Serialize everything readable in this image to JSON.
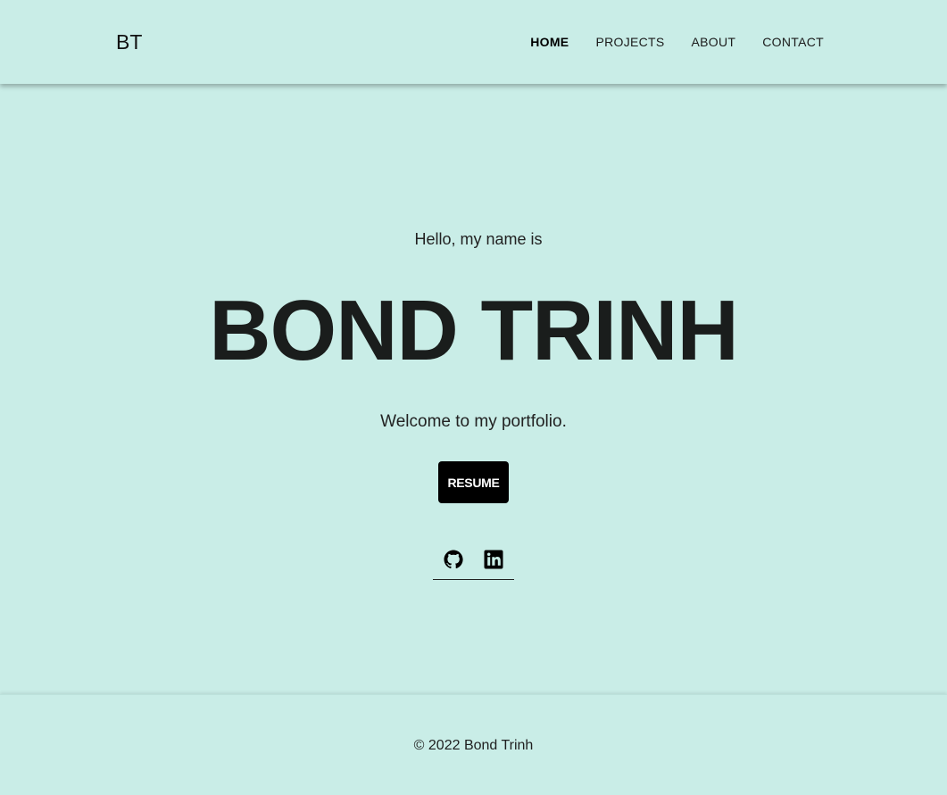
{
  "header": {
    "brand": "BT",
    "nav": [
      {
        "label": "HOME",
        "active": true
      },
      {
        "label": "PROJECTS",
        "active": false
      },
      {
        "label": "ABOUT",
        "active": false
      },
      {
        "label": "CONTACT",
        "active": false
      }
    ]
  },
  "hero": {
    "greeting": "Hello, my name is",
    "name": "BOND TRINH",
    "welcome": "Welcome to my portfolio.",
    "resume_label": "RESUME",
    "socials": [
      {
        "icon": "github-icon"
      },
      {
        "icon": "linkedin-icon"
      }
    ]
  },
  "footer": {
    "copyright": "© 2022 Bond Trinh"
  },
  "colors": {
    "background": "#c9ede7",
    "button": "#000000",
    "button_text": "#ffffff",
    "heading": "#1a1d1c"
  }
}
